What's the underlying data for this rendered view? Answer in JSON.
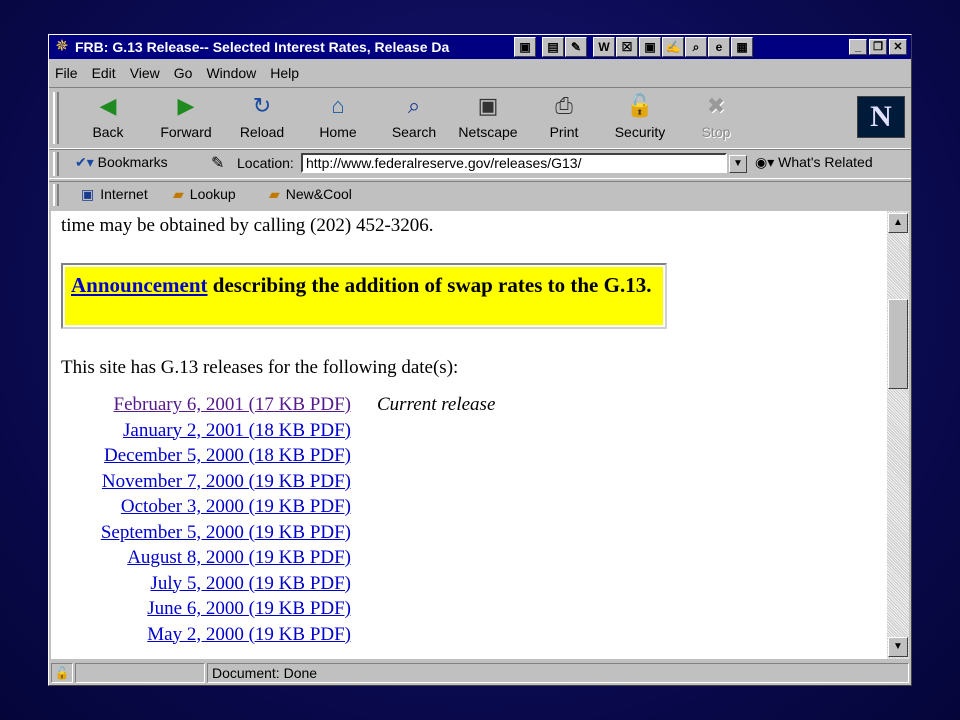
{
  "titlebar": {
    "title": "FRB: G.13 Release-- Selected Interest Rates, Release Da",
    "tray_icons": [
      "▣",
      "▤",
      "✎",
      "W",
      "☒",
      "▣",
      "✍",
      "⌕",
      "e",
      "▦"
    ]
  },
  "menu": [
    "File",
    "Edit",
    "View",
    "Go",
    "Window",
    "Help"
  ],
  "nav": [
    {
      "label": "Back",
      "icon": "◀"
    },
    {
      "label": "Forward",
      "icon": "▶"
    },
    {
      "label": "Reload",
      "icon": "↻"
    },
    {
      "label": "Home",
      "icon": "⌂"
    },
    {
      "label": "Search",
      "icon": "⌕"
    },
    {
      "label": "Netscape",
      "icon": "▣"
    },
    {
      "label": "Print",
      "icon": "⎙"
    },
    {
      "label": "Security",
      "icon": "ὑ2"
    },
    {
      "label": "Stop",
      "icon": "✖"
    }
  ],
  "logo_letter": "N",
  "location": {
    "bookmarks_label": "Bookmarks",
    "label": "Location:",
    "url": "http://www.federalreserve.gov/releases/G13/",
    "related_label": "What's Related"
  },
  "personal_toolbar": [
    "Internet",
    "Lookup",
    "New&Cool"
  ],
  "content": {
    "top_text": "time may be obtained by calling (202) 452-3206.",
    "announcement_link": "Announcement",
    "announcement_text": " describing the addition of swap rates to the G.13.",
    "dates_intro": "This site has G.13 releases for the following date(s):",
    "current_note": "Current release",
    "releases": [
      "February 6, 2001 (17 KB PDF)",
      "January 2, 2001 (18 KB PDF)",
      "December 5, 2000 (18 KB PDF)",
      "November 7, 2000 (19 KB PDF)",
      "October 3, 2000 (19 KB PDF)",
      "September 5, 2000 (19 KB PDF)",
      "August 8, 2000 (19 KB PDF)",
      "July 5, 2000 (19 KB PDF)",
      "June 6, 2000 (19 KB PDF)",
      "May 2, 2000 (19 KB PDF)"
    ]
  },
  "status": {
    "text": "Document: Done"
  }
}
